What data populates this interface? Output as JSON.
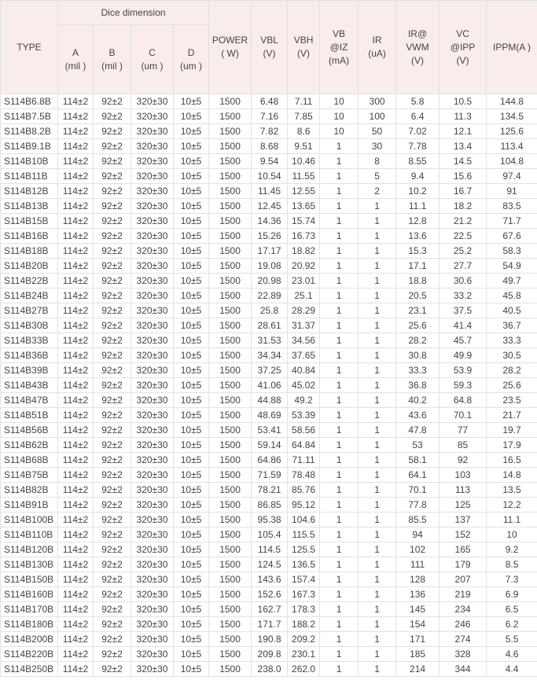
{
  "table": {
    "headers": {
      "type": "TYPE",
      "dice_group": "Dice dimension",
      "a": [
        "A",
        "(mil )"
      ],
      "b": [
        "B",
        "(mil )"
      ],
      "c": [
        "C",
        "(um )"
      ],
      "d": [
        "D",
        "(um )"
      ],
      "power": [
        "POWER",
        "( W)"
      ],
      "vbl": [
        "VBL",
        "(V)"
      ],
      "vbh": [
        "VBH",
        "(V)"
      ],
      "vb": [
        "VB",
        "@IZ",
        "(mA)"
      ],
      "ir": [
        "IR",
        "(uA)"
      ],
      "irvwm": [
        "IR@",
        "VWM",
        "(V)"
      ],
      "vc": [
        "VC",
        "@IPP",
        "(V)"
      ],
      "ippm": "IPPM(A )"
    },
    "rows": [
      [
        "S114B6.8B",
        "114±2",
        "92±2",
        "320±30",
        "10±5",
        "1500",
        "6.48",
        "7.11",
        "10",
        "300",
        "5.8",
        "10.5",
        "144.8"
      ],
      [
        "S114B7.5B",
        "114±2",
        "92±2",
        "320±30",
        "10±5",
        "1500",
        "7.16",
        "7.85",
        "10",
        "100",
        "6.4",
        "11.3",
        "134.5"
      ],
      [
        "S114B8.2B",
        "114±2",
        "92±2",
        "320±30",
        "10±5",
        "1500",
        "7.82",
        "8.6",
        "10",
        "50",
        "7.02",
        "12.1",
        "125.6"
      ],
      [
        "S114B9.1B",
        "114±2",
        "92±2",
        "320±30",
        "10±5",
        "1500",
        "8.68",
        "9.51",
        "1",
        "30",
        "7.78",
        "13.4",
        "113.4"
      ],
      [
        "S114B10B",
        "114±2",
        "92±2",
        "320±30",
        "10±5",
        "1500",
        "9.54",
        "10.46",
        "1",
        "8",
        "8.55",
        "14.5",
        "104.8"
      ],
      [
        "S114B11B",
        "114±2",
        "92±2",
        "320±30",
        "10±5",
        "1500",
        "10.54",
        "11.55",
        "1",
        "5",
        "9.4",
        "15.6",
        "97.4"
      ],
      [
        "S114B12B",
        "114±2",
        "92±2",
        "320±30",
        "10±5",
        "1500",
        "11.45",
        "12.55",
        "1",
        "2",
        "10.2",
        "16.7",
        "91"
      ],
      [
        "S114B13B",
        "114±2",
        "92±2",
        "320±30",
        "10±5",
        "1500",
        "12.45",
        "13.65",
        "1",
        "1",
        "11.1",
        "18.2",
        "83.5"
      ],
      [
        "S114B15B",
        "114±2",
        "92±2",
        "320±30",
        "10±5",
        "1500",
        "14.36",
        "15.74",
        "1",
        "1",
        "12.8",
        "21.2",
        "71.7"
      ],
      [
        "S114B16B",
        "114±2",
        "92±2",
        "320±30",
        "10±5",
        "1500",
        "15.26",
        "16.73",
        "1",
        "1",
        "13.6",
        "22.5",
        "67.6"
      ],
      [
        "S114B18B",
        "114±2",
        "92±2",
        "320±30",
        "10±5",
        "1500",
        "17.17",
        "18.82",
        "1",
        "1",
        "15.3",
        "25.2",
        "58.3"
      ],
      [
        "S114B20B",
        "114±2",
        "92±2",
        "320±30",
        "10±5",
        "1500",
        "19.08",
        "20.92",
        "1",
        "1",
        "17.1",
        "27.7",
        "54.9"
      ],
      [
        "S114B22B",
        "114±2",
        "92±2",
        "320±30",
        "10±5",
        "1500",
        "20.98",
        "23.01",
        "1",
        "1",
        "18.8",
        "30.6",
        "49.7"
      ],
      [
        "S114B24B",
        "114±2",
        "92±2",
        "320±30",
        "10±5",
        "1500",
        "22.89",
        "25.1",
        "1",
        "1",
        "20.5",
        "33.2",
        "45.8"
      ],
      [
        "S114B27B",
        "114±2",
        "92±2",
        "320±30",
        "10±5",
        "1500",
        "25.8",
        "28.29",
        "1",
        "1",
        "23.1",
        "37.5",
        "40.5"
      ],
      [
        "S114B30B",
        "114±2",
        "92±2",
        "320±30",
        "10±5",
        "1500",
        "28.61",
        "31.37",
        "1",
        "1",
        "25.6",
        "41.4",
        "36.7"
      ],
      [
        "S114B33B",
        "114±2",
        "92±2",
        "320±30",
        "10±5",
        "1500",
        "31.53",
        "34.56",
        "1",
        "1",
        "28.2",
        "45.7",
        "33.3"
      ],
      [
        "S114B36B",
        "114±2",
        "92±2",
        "320±30",
        "10±5",
        "1500",
        "34.34",
        "37.65",
        "1",
        "1",
        "30.8",
        "49.9",
        "30.5"
      ],
      [
        "S114B39B",
        "114±2",
        "92±2",
        "320±30",
        "10±5",
        "1500",
        "37.25",
        "40.84",
        "1",
        "1",
        "33.3",
        "53.9",
        "28.2"
      ],
      [
        "S114B43B",
        "114±2",
        "92±2",
        "320±30",
        "10±5",
        "1500",
        "41.06",
        "45.02",
        "1",
        "1",
        "36.8",
        "59.3",
        "25.6"
      ],
      [
        "S114B47B",
        "114±2",
        "92±2",
        "320±30",
        "10±5",
        "1500",
        "44.88",
        "49.2",
        "1",
        "1",
        "40.2",
        "64.8",
        "23.5"
      ],
      [
        "S114B51B",
        "114±2",
        "92±2",
        "320±30",
        "10±5",
        "1500",
        "48.69",
        "53.39",
        "1",
        "1",
        "43.6",
        "70.1",
        "21.7"
      ],
      [
        "S114B56B",
        "114±2",
        "92±2",
        "320±30",
        "10±5",
        "1500",
        "53.41",
        "58.56",
        "1",
        "1",
        "47.8",
        "77",
        "19.7"
      ],
      [
        "S114B62B",
        "114±2",
        "92±2",
        "320±30",
        "10±5",
        "1500",
        "59.14",
        "64.84",
        "1",
        "1",
        "53",
        "85",
        "17.9"
      ],
      [
        "S114B68B",
        "114±2",
        "92±2",
        "320±30",
        "10±5",
        "1500",
        "64.86",
        "71.11",
        "1",
        "1",
        "58.1",
        "92",
        "16.5"
      ],
      [
        "S114B75B",
        "114±2",
        "92±2",
        "320±30",
        "10±5",
        "1500",
        "71.59",
        "78.48",
        "1",
        "1",
        "64.1",
        "103",
        "14.8"
      ],
      [
        "S114B82B",
        "114±2",
        "92±2",
        "320±30",
        "10±5",
        "1500",
        "78.21",
        "85.76",
        "1",
        "1",
        "70.1",
        "113",
        "13.5"
      ],
      [
        "S114B91B",
        "114±2",
        "92±2",
        "320±30",
        "10±5",
        "1500",
        "86.85",
        "95.12",
        "1",
        "1",
        "77.8",
        "125",
        "12.2"
      ],
      [
        "S114B100B",
        "114±2",
        "92±2",
        "320±30",
        "10±5",
        "1500",
        "95.38",
        "104.6",
        "1",
        "1",
        "85.5",
        "137",
        "11.1"
      ],
      [
        "S114B110B",
        "114±2",
        "92±2",
        "320±30",
        "10±5",
        "1500",
        "105.4",
        "115.5",
        "1",
        "1",
        "94",
        "152",
        "10"
      ],
      [
        "S114B120B",
        "114±2",
        "92±2",
        "320±30",
        "10±5",
        "1500",
        "114.5",
        "125.5",
        "1",
        "1",
        "102",
        "165",
        "9.2"
      ],
      [
        "S114B130B",
        "114±2",
        "92±2",
        "320±30",
        "10±5",
        "1500",
        "124.5",
        "136.5",
        "1",
        "1",
        "111",
        "179",
        "8.5"
      ],
      [
        "S114B150B",
        "114±2",
        "92±2",
        "320±30",
        "10±5",
        "1500",
        "143.6",
        "157.4",
        "1",
        "1",
        "128",
        "207",
        "7.3"
      ],
      [
        "S114B160B",
        "114±2",
        "92±2",
        "320±30",
        "10±5",
        "1500",
        "152.6",
        "167.3",
        "1",
        "1",
        "136",
        "219",
        "6.9"
      ],
      [
        "S114B170B",
        "114±2",
        "92±2",
        "320±30",
        "10±5",
        "1500",
        "162.7",
        "178.3",
        "1",
        "1",
        "145",
        "234",
        "6.5"
      ],
      [
        "S114B180B",
        "114±2",
        "92±2",
        "320±30",
        "10±5",
        "1500",
        "171.7",
        "188.2",
        "1",
        "1",
        "154",
        "246",
        "6.2"
      ],
      [
        "S114B200B",
        "114±2",
        "92±2",
        "320±30",
        "10±5",
        "1500",
        "190.8",
        "209.2",
        "1",
        "1",
        "171",
        "274",
        "5.5"
      ],
      [
        "S114B220B",
        "114±2",
        "92±2",
        "320±30",
        "10±5",
        "1500",
        "209.8",
        "230.1",
        "1",
        "1",
        "185",
        "328",
        "4.6"
      ],
      [
        "S114B250B",
        "114±2",
        "92±2",
        "320±30",
        "10±5",
        "1500",
        "238.0",
        "262.0",
        "1",
        "1",
        "214",
        "344",
        "4.4"
      ]
    ]
  },
  "colors": {
    "header_background": "#f8ecec",
    "border": "#e2e2e2",
    "text": "#444444"
  }
}
